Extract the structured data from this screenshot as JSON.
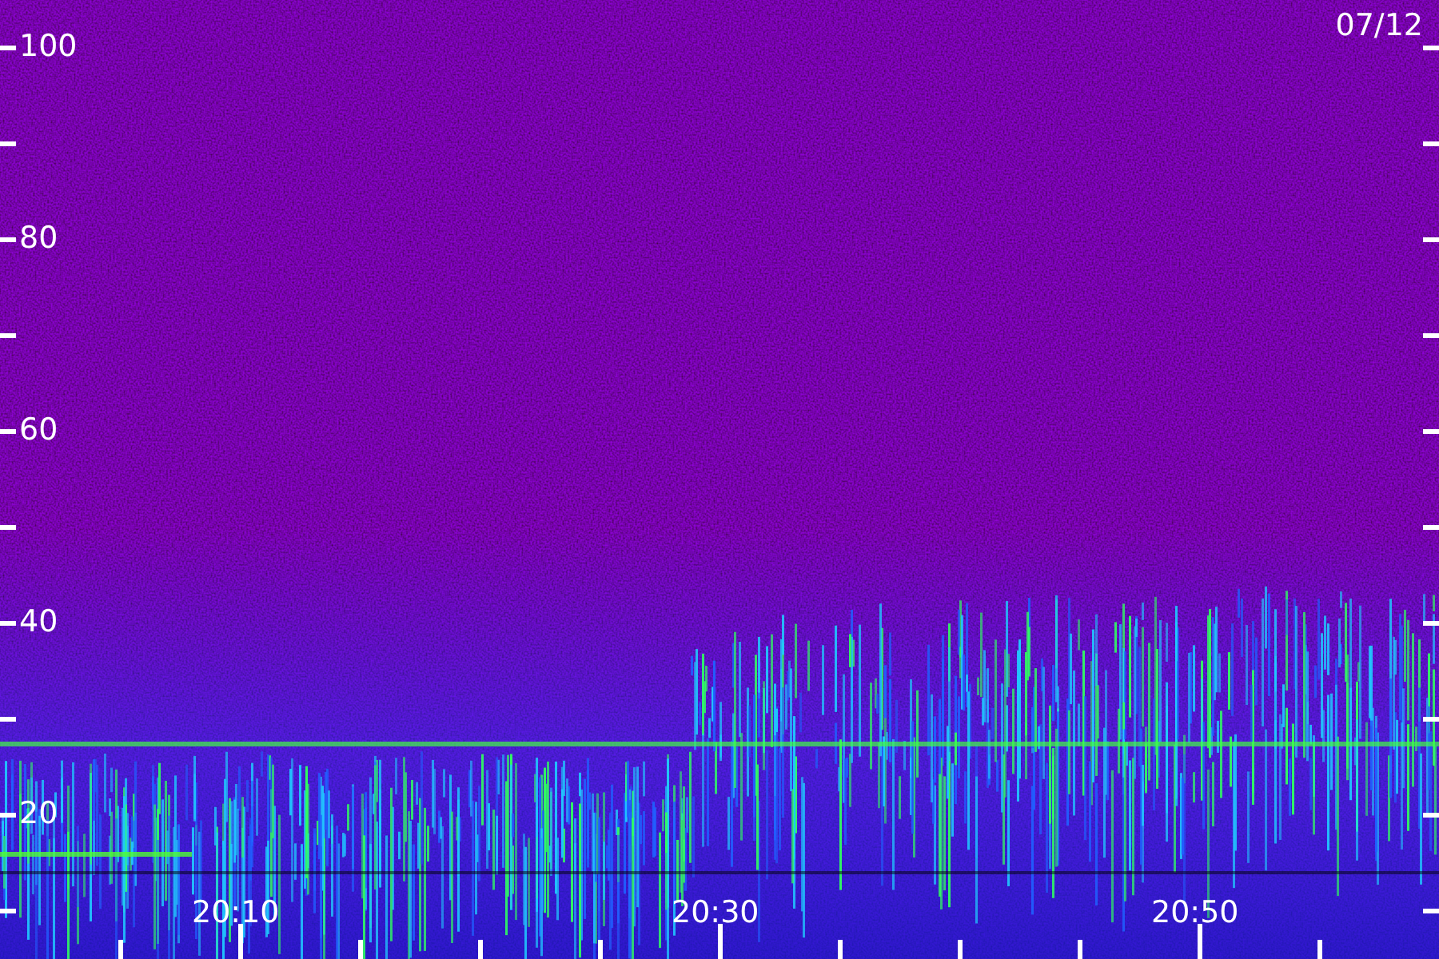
{
  "date": "07/12",
  "y_axis": {
    "labels": [
      "100",
      "80",
      "60",
      "40",
      "20"
    ]
  },
  "x_axis": {
    "labels": [
      "20:10",
      "20:30",
      "20:50"
    ]
  }
}
